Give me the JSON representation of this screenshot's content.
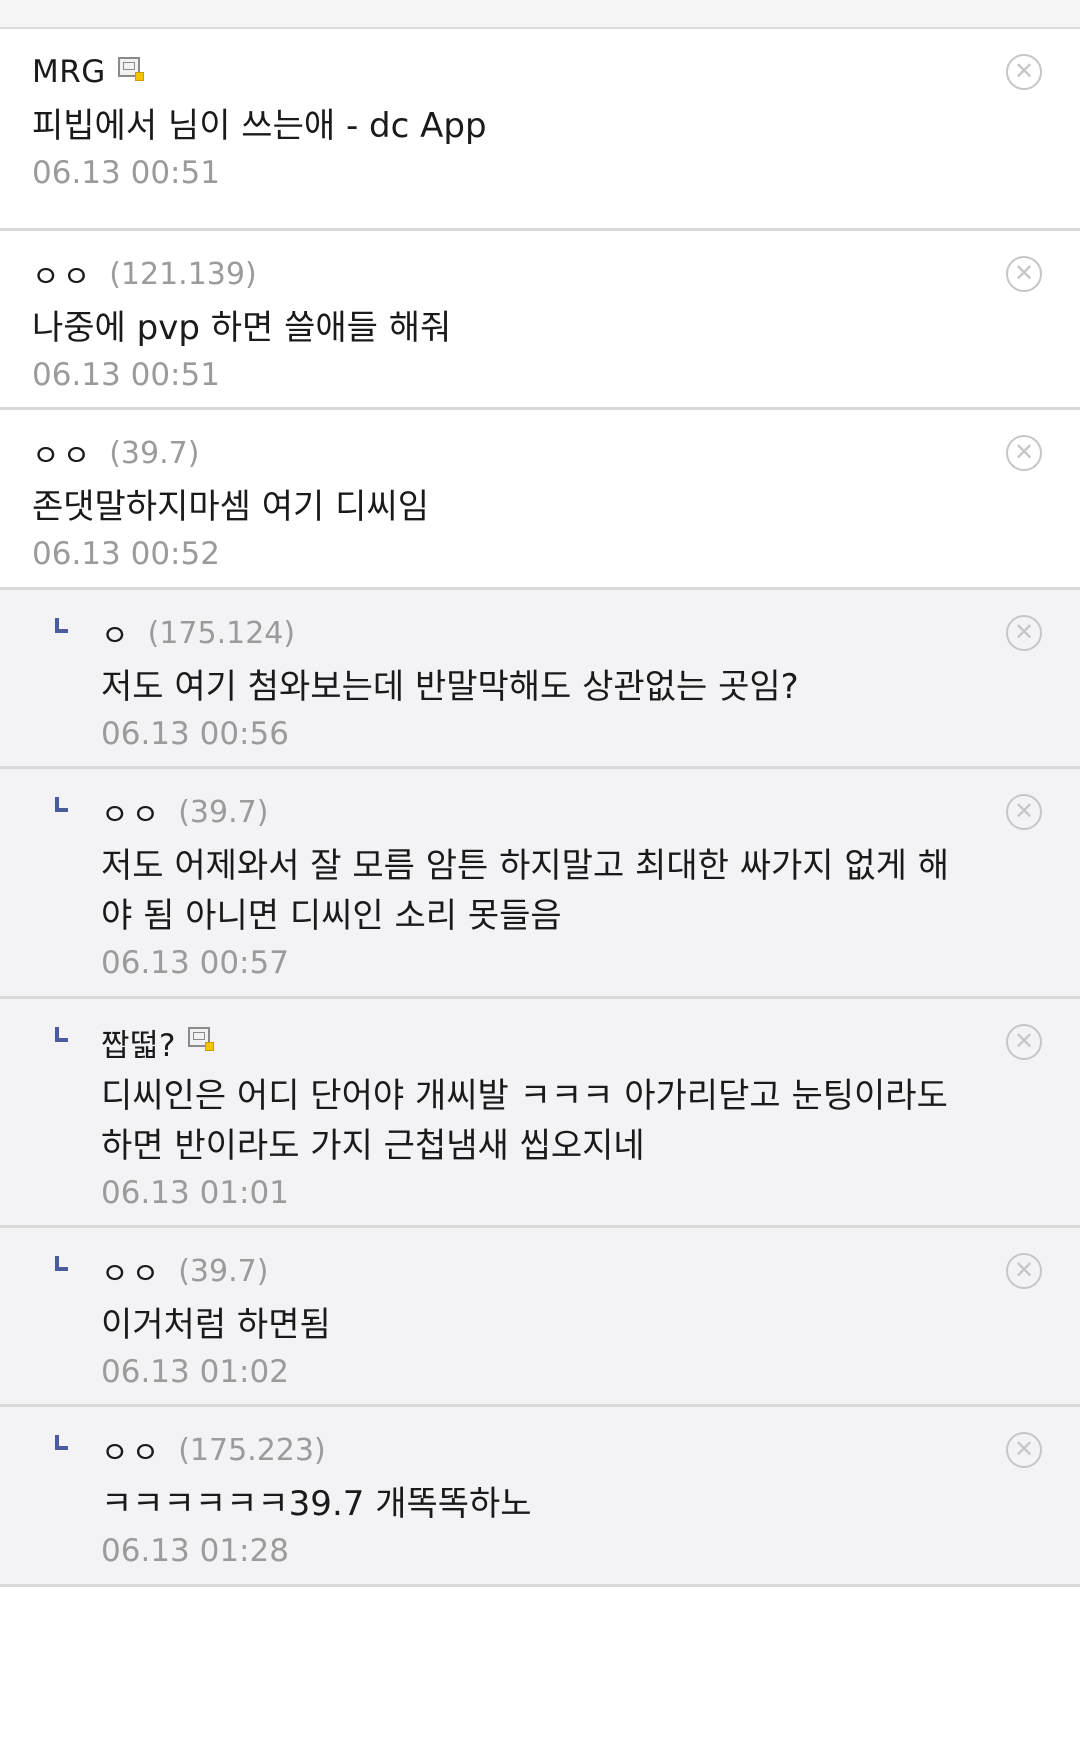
{
  "comments": [
    {
      "nick": "MRG",
      "ip": "",
      "gallog": true,
      "text": "피빕에서 님이 쓰는애 - dc App",
      "date": "06.13 00:51",
      "reply": false
    },
    {
      "nick": "ㅇㅇ",
      "ip": "(121.139)",
      "gallog": false,
      "text": "나중에 pvp 하면 쓸애들 해줘",
      "date": "06.13 00:51",
      "reply": false
    },
    {
      "nick": "ㅇㅇ",
      "ip": "(39.7)",
      "gallog": false,
      "text": "존댓말하지마셈 여기 디씨임",
      "date": "06.13 00:52",
      "reply": false
    },
    {
      "nick": "ㅇ",
      "ip": "(175.124)",
      "gallog": false,
      "text": "저도 여기 첨와보는데 반말막해도 상관없는 곳임?",
      "date": "06.13 00:56",
      "reply": true
    },
    {
      "nick": "ㅇㅇ",
      "ip": "(39.7)",
      "gallog": false,
      "text": "저도 어제와서 잘 모름 암튼 하지말고 최대한 싸가지 없게 해야 됨 아니면 디씨인 소리 못들음",
      "date": "06.13 00:57",
      "reply": true
    },
    {
      "nick": "짭떫?",
      "ip": "",
      "gallog": true,
      "text": "디씨인은 어디 단어야 개씨발 ㅋㅋㅋ 아가리닫고 눈팅이라도 하면 반이라도 가지 근첩냄새 씹오지네",
      "date": "06.13 01:01",
      "reply": true
    },
    {
      "nick": "ㅇㅇ",
      "ip": "(39.7)",
      "gallog": false,
      "text": "이거처럼 하면됨",
      "date": "06.13 01:02",
      "reply": true
    },
    {
      "nick": "ㅇㅇ",
      "ip": "(175.223)",
      "gallog": false,
      "text": "ㅋㅋㅋㅋㅋㅋ39.7 개똑똑하노",
      "date": "06.13 01:28",
      "reply": true
    }
  ],
  "icons": {
    "delete": "close-circle-icon",
    "reply": "reply-arrow-icon",
    "gallog": "gallog-icon"
  },
  "colors": {
    "reply_bg": "#f3f3f6",
    "reply_mark": "#4c5a9e",
    "meta_gray": "#9b9b9b",
    "divider": "#d9d9d9"
  }
}
